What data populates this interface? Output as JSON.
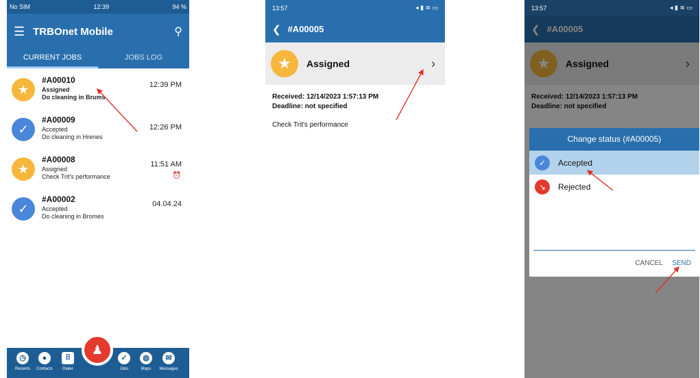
{
  "screen1": {
    "status": {
      "carrier": "No SIM",
      "time": "12:39",
      "battery": "94 %"
    },
    "app_title": "TRBOnet Mobile",
    "tabs": [
      "CURRENT JOBS",
      "JOBS LOG"
    ],
    "jobs": [
      {
        "id": "#A00010",
        "status": "Assigned",
        "desc": "Do cleaning in Brums",
        "time": "12:39 PM",
        "icon": "star-icon"
      },
      {
        "id": "#A00009",
        "status": "Accepted",
        "desc": "Do cleaning in Hrenes",
        "time": "12:26 PM",
        "icon": "check-icon"
      },
      {
        "id": "#A00008",
        "status": "Assigned",
        "desc": "Check Trit's performance",
        "time": "11:51 AM",
        "icon": "star-icon"
      },
      {
        "id": "#A00002",
        "status": "Accepted",
        "desc": "Do cleaning in Bromes",
        "time": "04.04.24",
        "icon": "check-icon"
      }
    ],
    "nav": [
      "Recents",
      "Contacts",
      "Dialer",
      "Jobs",
      "Maps",
      "Messages"
    ]
  },
  "screen2": {
    "status_time": "13:57",
    "title": "#A00005",
    "status_label": "Assigned",
    "received": "Received: 12/14/2023 1:57:13 PM",
    "deadline": "Deadline: not specified",
    "desc": "Check Trit's performance"
  },
  "screen3": {
    "status_time": "13:57",
    "title": "#A00005",
    "status_label": "Assigned",
    "received": "Received: 12/14/2023 1:57:13 PM",
    "deadline": "Deadline: not specified",
    "dialog_title": "Change status (#A00005)",
    "options": [
      "Accepted",
      "Rejected"
    ],
    "cancel": "CANCEL",
    "send": "SEND"
  },
  "colors": {
    "primary": "#2a6fad",
    "dark": "#1e5d94",
    "star": "#f6b73c",
    "accepted": "#4a86d9",
    "rejected": "#e23b2e"
  }
}
